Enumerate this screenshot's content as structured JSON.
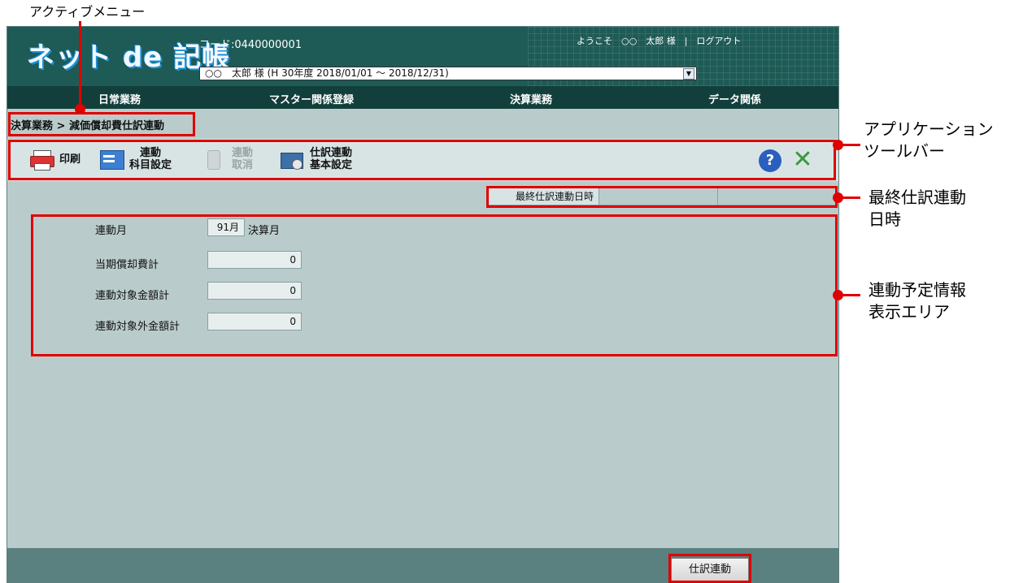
{
  "annotations": {
    "active_menu": "アクティブメニュー",
    "app_toolbar_line1": "アプリケーション",
    "app_toolbar_line2": "ツールバー",
    "last_date_line1": "最終仕訳連動",
    "last_date_line2": "日時",
    "info_area_line1": "連動予定情報",
    "info_area_line2": "表示エリア"
  },
  "header": {
    "logo": "ネット de 記帳",
    "code": "コード:0440000001",
    "welcome": "ようこそ　○○　太郎 様　|　ログアウト",
    "company_select": "○○　太郎 様 (H 30年度 2018/01/01 ～ 2018/12/31)"
  },
  "menu": [
    "日常業務",
    "マスター関係登録",
    "決算業務",
    "データ関係"
  ],
  "breadcrumb": "決算業務 > 減価償却費仕訳連動",
  "toolbar": {
    "print": "印刷",
    "link_account_1": "連動",
    "link_account_2": "科目設定",
    "link_cancel_1": "連動",
    "link_cancel_2": "取消",
    "journal_settings_1": "仕訳連動",
    "journal_settings_2": "基本設定",
    "help_icon": "help-icon",
    "close_icon": "close-icon"
  },
  "last_date": {
    "label": "最終仕訳連動日時",
    "value": ""
  },
  "form": {
    "month_label": "連動月",
    "month_value": "91月",
    "month_suffix": "決算月",
    "depreciation_label": "当期償却費計",
    "depreciation_value": "0",
    "target_label": "連動対象金額計",
    "target_value": "0",
    "non_target_label": "連動対象外金額計",
    "non_target_value": "0"
  },
  "footer": {
    "journal_button": "仕訳連動"
  },
  "colors": {
    "accent_red": "#e00000",
    "header": "#1e5b56",
    "menubar": "#123f3c",
    "content": "#b9cccb",
    "toolbar": "#d8e4e4",
    "footer": "#5a8080"
  }
}
